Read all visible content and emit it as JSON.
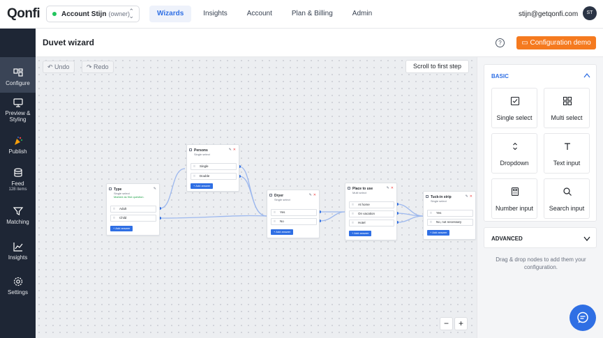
{
  "brand": {
    "logo": "Qonfi"
  },
  "account": {
    "name": "Account Stijn",
    "role": "(owner)"
  },
  "nav": {
    "tabs": [
      {
        "label": "Wizards"
      },
      {
        "label": "Insights"
      },
      {
        "label": "Account"
      },
      {
        "label": "Plan & Billing"
      },
      {
        "label": "Admin"
      }
    ]
  },
  "user": {
    "email": "stijn@getqonfi.com",
    "initials": "ST"
  },
  "sidebar": {
    "items": [
      {
        "label": "Configure",
        "icon": "configure-icon"
      },
      {
        "label": "Preview & Styling",
        "icon": "monitor-icon"
      },
      {
        "label": "Publish",
        "icon": "party-popper-icon"
      },
      {
        "label": "Feed",
        "sub": "128 items",
        "icon": "database-icon"
      },
      {
        "label": "Matching",
        "icon": "filter-icon"
      },
      {
        "label": "Insights",
        "icon": "chart-icon"
      },
      {
        "label": "Settings",
        "icon": "gear-icon"
      }
    ]
  },
  "page": {
    "title": "Duvet wizard",
    "demo_label": "Configuration demo",
    "help": "?"
  },
  "toolbar": {
    "undo": "Undo",
    "redo": "Redo",
    "scroll": "Scroll to first step",
    "zoom_out": "−",
    "zoom_in": "+"
  },
  "nodes": [
    {
      "title": "Type",
      "subtitle": "Single select",
      "flag": "Marked as first question.",
      "answers": [
        "Adult",
        "Child"
      ],
      "add": "+ Add answer"
    },
    {
      "title": "Persons",
      "subtitle": "Single select",
      "answers": [
        "Single",
        "Double"
      ],
      "add": "+ Add answer"
    },
    {
      "title": "Dryer",
      "subtitle": "Single select",
      "answers": [
        "Yes",
        "No"
      ],
      "add": "+ Add answer"
    },
    {
      "title": "Place to use",
      "subtitle": "Multi select",
      "answers": [
        "At home",
        "On vacation",
        "Hotel"
      ],
      "add": "+ Add answer"
    },
    {
      "title": "Tuck-in strip",
      "subtitle": "Single select",
      "answers": [
        "Yes",
        "No, not necessary"
      ],
      "add": "+ Add answer"
    }
  ],
  "panel": {
    "basic_label": "BASIC",
    "advanced_label": "ADVANCED",
    "items": [
      {
        "label": "Single select",
        "icon": "checkbox-icon"
      },
      {
        "label": "Multi select",
        "icon": "grid-icon"
      },
      {
        "label": "Dropdown",
        "icon": "chevron-updown-icon"
      },
      {
        "label": "Text input",
        "icon": "text-icon"
      },
      {
        "label": "Number input",
        "icon": "calculator-icon"
      },
      {
        "label": "Search input",
        "icon": "search-icon"
      }
    ],
    "hint": "Drag & drop nodes to add them your configuration."
  },
  "colors": {
    "accent": "#2f6fe4",
    "demo": "#f57a1f",
    "sidebar": "#1e2635"
  }
}
